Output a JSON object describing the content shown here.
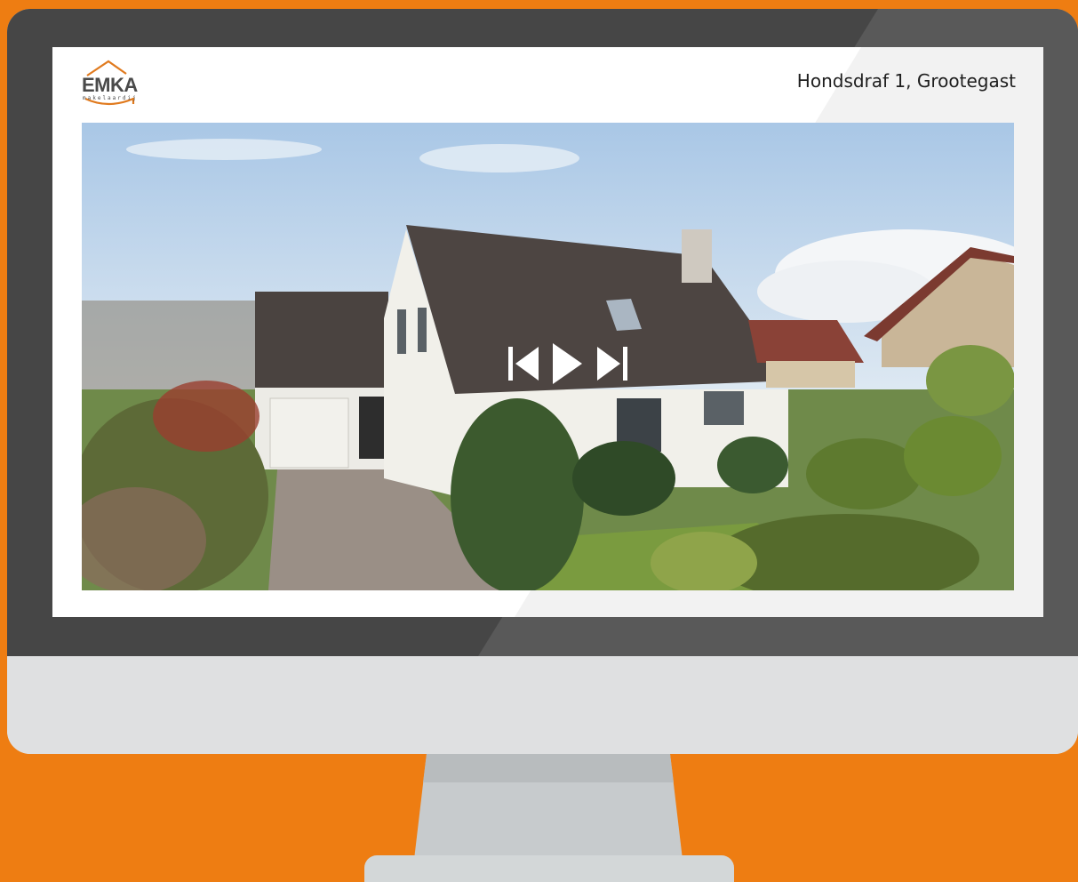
{
  "brand": {
    "name": "EMKA",
    "subtitle": "makelaardij"
  },
  "listing": {
    "address": "Hondsdraf 1, Grootegast"
  },
  "player": {
    "previous_icon": "skip-previous-icon",
    "play_icon": "play-icon",
    "next_icon": "skip-next-icon"
  },
  "colors": {
    "background": "#ee7d12",
    "bezel": "#464646",
    "chin": "#dfe0e1",
    "logo_accent": "#e07a1e",
    "control": "#ffffff"
  }
}
